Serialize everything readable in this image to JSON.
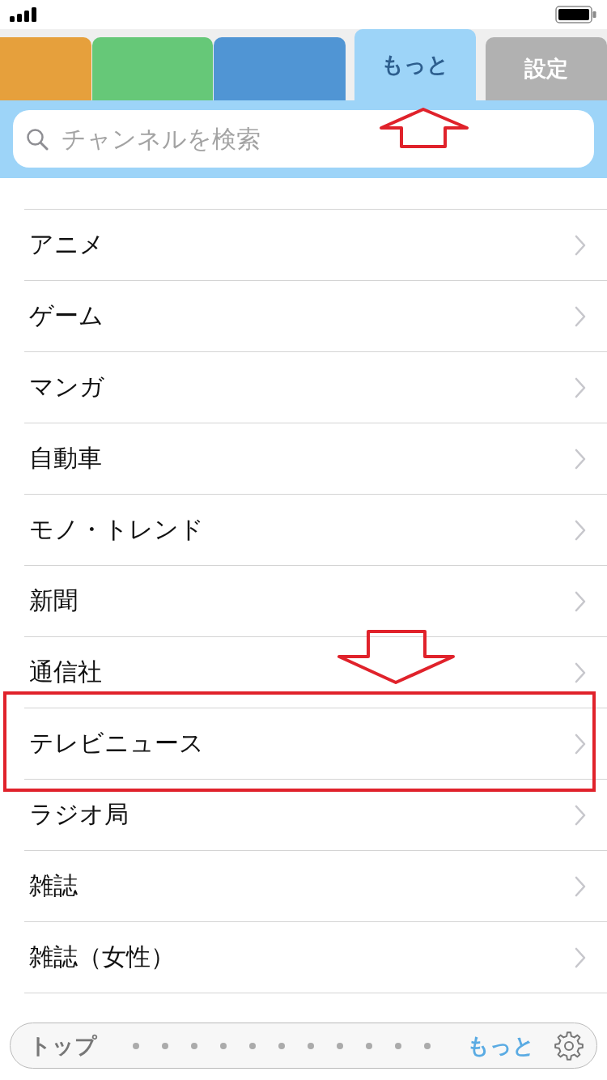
{
  "tabs": [
    {
      "color": "#e6a03c",
      "selected": false,
      "marked": false
    },
    {
      "color": "#66c878",
      "selected": false,
      "marked": false
    },
    {
      "color": "#5095d4",
      "selected": false,
      "marked": false
    },
    {
      "label": "もっと",
      "color": "#9dd4f8",
      "selected": true,
      "marked": true
    },
    {
      "label": "設定",
      "color": "#b1b1b1",
      "selected": false,
      "marked": false
    }
  ],
  "search": {
    "placeholder": "チャンネルを検索"
  },
  "list": [
    {
      "label": "アニメ",
      "marked": false
    },
    {
      "label": "ゲーム",
      "marked": false
    },
    {
      "label": "マンガ",
      "marked": false
    },
    {
      "label": "自動車",
      "marked": false
    },
    {
      "label": "モノ・トレンド",
      "marked": false
    },
    {
      "label": "新聞",
      "marked": false
    },
    {
      "label": "通信社",
      "marked": false
    },
    {
      "label": "テレビニュース",
      "marked": true
    },
    {
      "label": "ラジオ局",
      "marked": false
    },
    {
      "label": "雑誌",
      "marked": false
    },
    {
      "label": "雑誌（女性）",
      "marked": false
    }
  ],
  "bottom_nav": {
    "items": [
      {
        "kind": "label",
        "label": "トップ",
        "selected": false
      },
      {
        "kind": "dot",
        "selected": false
      },
      {
        "kind": "dot",
        "selected": false
      },
      {
        "kind": "dot",
        "selected": false
      },
      {
        "kind": "dot",
        "selected": false
      },
      {
        "kind": "dot",
        "selected": false
      },
      {
        "kind": "dot",
        "selected": false
      },
      {
        "kind": "dot",
        "selected": false
      },
      {
        "kind": "dot",
        "selected": false
      },
      {
        "kind": "dot",
        "selected": false
      },
      {
        "kind": "dot",
        "selected": false
      },
      {
        "kind": "dot",
        "selected": false
      },
      {
        "kind": "label",
        "label": "もっと",
        "selected": true
      }
    ]
  }
}
